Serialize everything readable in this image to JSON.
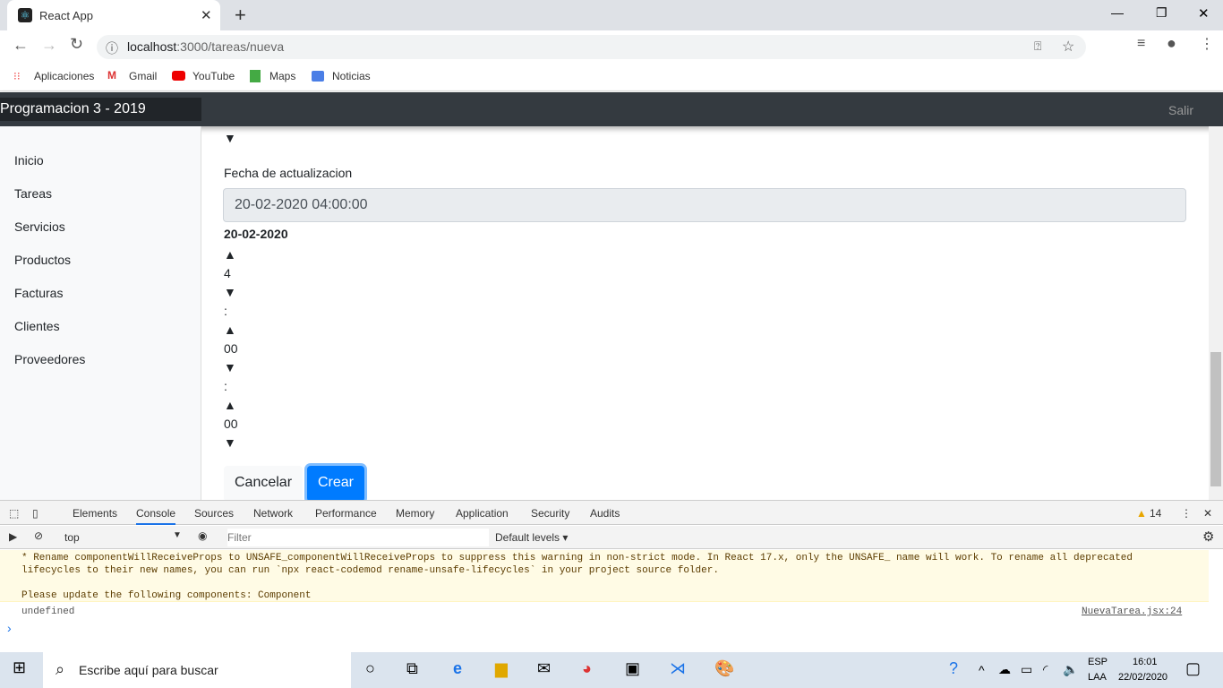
{
  "browser": {
    "tab_title": "React App",
    "url_host": "localhost",
    "url_path": ":3000/tareas/nueva",
    "bookmarks": [
      "Aplicaciones",
      "Gmail",
      "YouTube",
      "Maps",
      "Noticias"
    ]
  },
  "navbar": {
    "brand": "Programacion 3 - 2019",
    "logout": "Salir"
  },
  "sidebar": {
    "items": [
      "Inicio",
      "Tareas",
      "Servicios",
      "Productos",
      "Facturas",
      "Clientes",
      "Proveedores"
    ]
  },
  "form": {
    "top_arrow": "▼",
    "label": "Fecha de actualizacion",
    "date_value": "20-02-2020 04:00:00",
    "picker_date": "20-02-2020",
    "up": "▲",
    "down": "▼",
    "hour": "4",
    "sep": ":",
    "minute": "00",
    "second": "00",
    "cancel": "Cancelar",
    "create": "Crear"
  },
  "devtools": {
    "tabs": [
      "Elements",
      "Console",
      "Sources",
      "Network",
      "Performance",
      "Memory",
      "Application",
      "Security",
      "Audits"
    ],
    "active_tab": "Console",
    "warnings": "14",
    "context": "top",
    "filter_placeholder": "Filter",
    "levels": "Default levels ▾",
    "messages": {
      "line1": "* Rename componentWillReceiveProps to UNSAFE_componentWillReceiveProps to suppress this warning in non-strict mode. In React 17.x, only the UNSAFE_ name will work. To rename all deprecated",
      "line2": "lifecycles to their new names, you can run `npx react-codemod rename-unsafe-lifecycles` in your project source folder.",
      "line3": "Please update the following components: Component",
      "log": "undefined",
      "source": "NuevaTarea.jsx:24",
      "prompt": "›"
    }
  },
  "taskbar": {
    "search_placeholder": "Escribe aquí para buscar",
    "lang1": "ESP",
    "lang2": "LAA",
    "time": "16:01",
    "date": "22/02/2020"
  }
}
